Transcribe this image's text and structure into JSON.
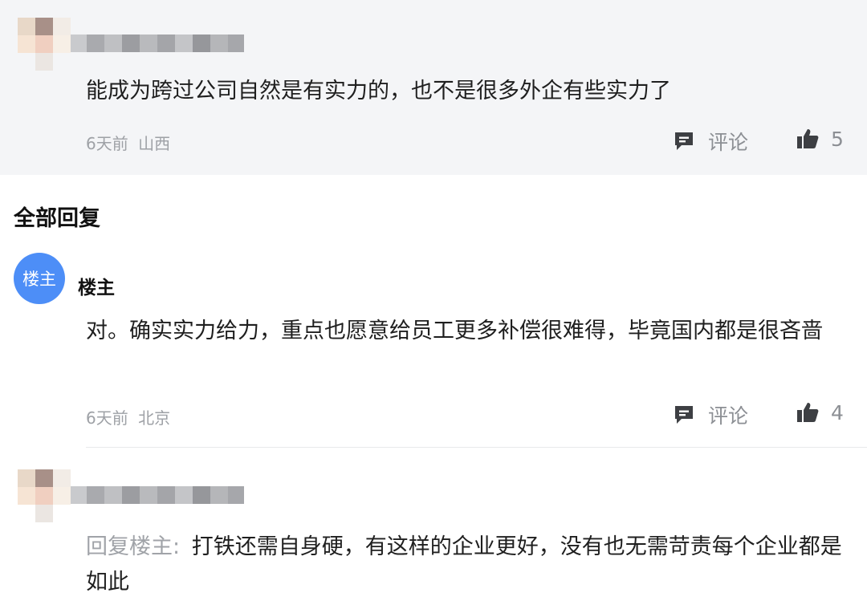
{
  "top_comment": {
    "text": "能成为跨过公司自然是有实力的，也不是很多外企有些实力了",
    "time": "6天前",
    "location": "山西",
    "comment_label": "评论",
    "like_count": "5",
    "icons": {
      "comment": "comment-bubble-icon",
      "like": "thumbs-up-icon"
    }
  },
  "replies_section": {
    "title": "全部回复"
  },
  "host_reply": {
    "avatar_text": "楼主",
    "author": "楼主",
    "text": "对。确实实力给力，重点也愿意给员工更多补偿很难得，毕竟国内都是很吝啬",
    "time": "6天前",
    "location": "北京",
    "comment_label": "评论",
    "like_count": "4",
    "avatar_color": "#4d8ef7"
  },
  "third_reply": {
    "reply_prefix": "回复楼主:",
    "text": "打铁还需自身硬，有这样的企业更好，没有也无需苛责每个企业都是如此"
  },
  "colors": {
    "top_card_bg": "#f4f5f7",
    "meta_text": "#9ea1a6",
    "accent_blue": "#4d8ef7"
  }
}
